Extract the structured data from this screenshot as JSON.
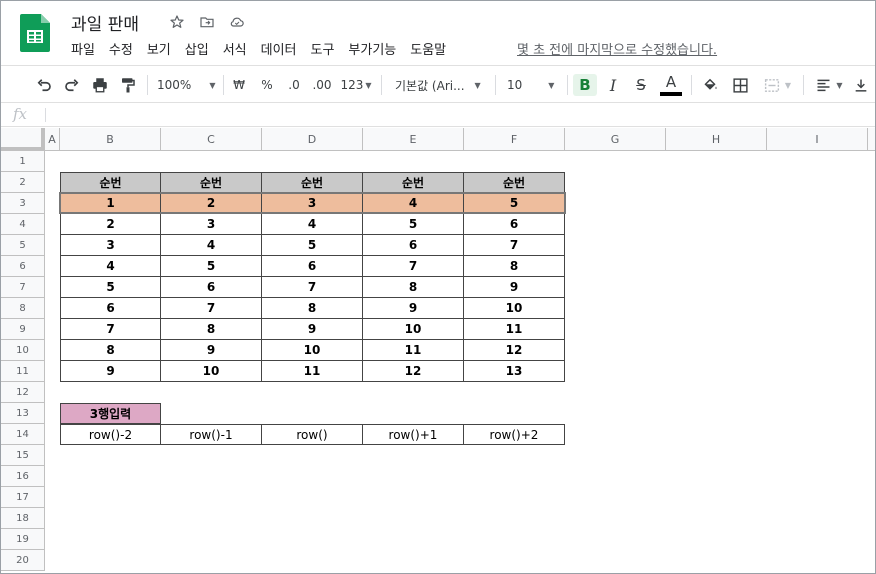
{
  "app": {
    "doc_title": "과일 판매",
    "menu": [
      "파일",
      "수정",
      "보기",
      "삽입",
      "서식",
      "데이터",
      "도구",
      "부가기능",
      "도움말"
    ],
    "last_edit": "몇 초 전에 마지막으로 수정했습니다."
  },
  "toolbar": {
    "zoom": "100%",
    "currency": "₩",
    "percent": "%",
    "decimal_decrease": ".0",
    "decimal_increase": ".00",
    "number_format": "123",
    "font": "기본값 (Ari...",
    "font_size": "10",
    "bold": "B",
    "italic": "I",
    "strike": "S",
    "text_color": "A"
  },
  "formula_bar": {
    "fx": "fx"
  },
  "columns": [
    "A",
    "B",
    "C",
    "D",
    "E",
    "F",
    "G",
    "H",
    "I"
  ],
  "rows": [
    "1",
    "2",
    "3",
    "4",
    "5",
    "6",
    "7",
    "8",
    "9",
    "10",
    "11",
    "12",
    "13",
    "14",
    "15",
    "16",
    "17",
    "18",
    "19",
    "20"
  ],
  "table": {
    "header": [
      "순번",
      "순번",
      "순번",
      "순번",
      "순번"
    ],
    "data": [
      [
        "1",
        "2",
        "3",
        "4",
        "5"
      ],
      [
        "2",
        "3",
        "4",
        "5",
        "6"
      ],
      [
        "3",
        "4",
        "5",
        "6",
        "7"
      ],
      [
        "4",
        "5",
        "6",
        "7",
        "8"
      ],
      [
        "5",
        "6",
        "7",
        "8",
        "9"
      ],
      [
        "6",
        "7",
        "8",
        "9",
        "10"
      ],
      [
        "7",
        "8",
        "9",
        "10",
        "11"
      ],
      [
        "8",
        "9",
        "10",
        "11",
        "12"
      ],
      [
        "9",
        "10",
        "11",
        "12",
        "13"
      ]
    ]
  },
  "input_label": "3행입력",
  "formulas": [
    "row()-2",
    "row()-1",
    "row()",
    "row()+1",
    "row()+2"
  ],
  "colors": {
    "header_fill": "#c9c9c9",
    "highlight_fill": "#eebd9d",
    "label_fill": "#dda8c5",
    "sheets_green": "#0f9d58"
  }
}
